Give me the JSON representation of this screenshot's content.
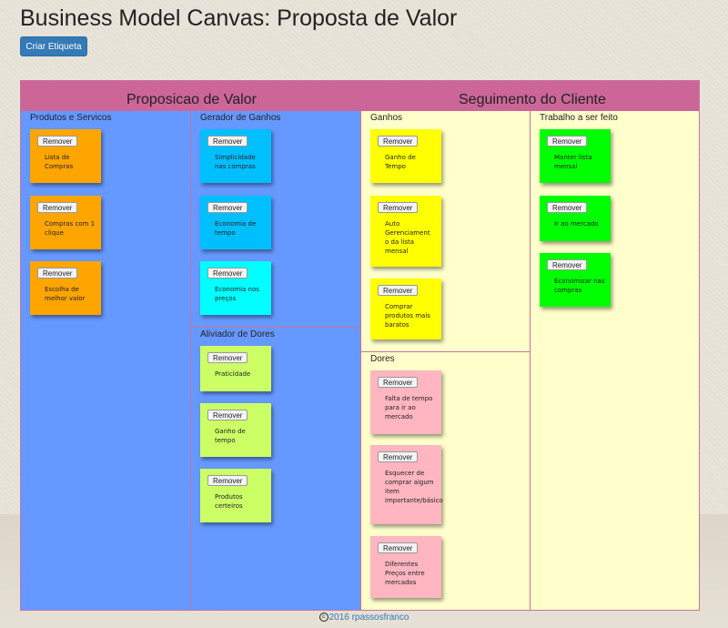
{
  "page": {
    "title": "Business Model Canvas: Proposta de Valor",
    "create_button": "Criar Etiqueta"
  },
  "headers": {
    "value_proposition": "Proposicao de Valor",
    "customer_segment": "Seguimento do Cliente"
  },
  "sections": {
    "products": {
      "label": "Produtos e Servicos",
      "notes": [
        {
          "remove": "Remover",
          "text": "Lista de Compras"
        },
        {
          "remove": "Remover",
          "text": "Compras com 1 clique"
        },
        {
          "remove": "Remover",
          "text": "Escolha de melhor valor"
        }
      ]
    },
    "gain_creators": {
      "label": "Gerador de Ganhos",
      "notes": [
        {
          "remove": "Remover",
          "text": "Simplicidade nas compras"
        },
        {
          "remove": "Remover",
          "text": "Economia de tempo"
        },
        {
          "remove": "Remover",
          "text": "Economia nos preços"
        }
      ]
    },
    "pain_relievers": {
      "label": "Aliviador de Dores",
      "notes": [
        {
          "remove": "Remover",
          "text": "Praticidade"
        },
        {
          "remove": "Remover",
          "text": "Ganho de tempo"
        },
        {
          "remove": "Remover",
          "text": "Produtos certeiros"
        }
      ]
    },
    "gains": {
      "label": "Ganhos",
      "notes": [
        {
          "remove": "Remover",
          "text": "Ganho de Tempo"
        },
        {
          "remove": "Remover",
          "text": "Auto Gerenciament o da lista mensal"
        },
        {
          "remove": "Remover",
          "text": "Comprar produtos mais baratos"
        }
      ]
    },
    "pains": {
      "label": "Dores",
      "notes": [
        {
          "remove": "Remover",
          "text": "Falta de tempo para ir ao mercado"
        },
        {
          "remove": "Remover",
          "text": "Esquecer de comprar algum item importante/básico"
        },
        {
          "remove": "Remover",
          "text": "Diferentes Preços entre mercados"
        }
      ]
    },
    "jobs": {
      "label": "Trabalho a ser feito",
      "notes": [
        {
          "remove": "Remover",
          "text": "Manter lista mensal"
        },
        {
          "remove": "Remover",
          "text": "Ir ao mercado"
        },
        {
          "remove": "Remover",
          "text": "Economizar nas compras"
        }
      ]
    }
  },
  "footer": {
    "text": "2016 rpassosfranco",
    "icon": "copyright-icon"
  },
  "colors": {
    "header_band": "#cc6699",
    "value_columns_bg": "#6699ff",
    "customer_columns_bg": "#ffffcc",
    "note_orange": "#ffa500",
    "note_blue": "#00bfff",
    "note_cyan": "#00ffff",
    "note_lime": "#ccff66",
    "note_yellow": "#ffff00",
    "note_pink": "#ffb6c1",
    "note_green": "#00ff00"
  }
}
